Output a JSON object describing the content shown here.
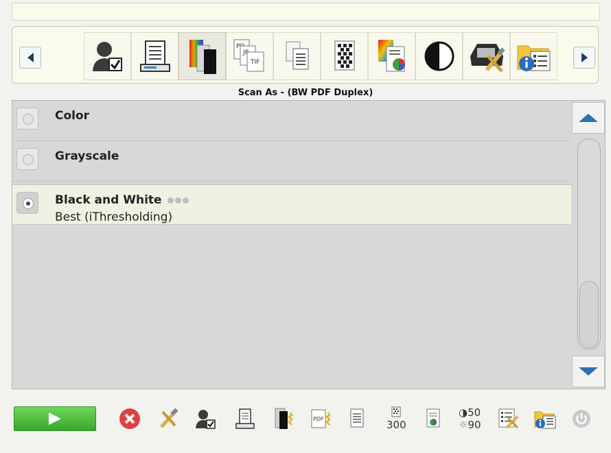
{
  "colors": {
    "accent": "#2d6fb0",
    "start": "#4dbb3c",
    "selected_row": "#f1f1e3"
  },
  "toolbar": {
    "left_icon": "triangle-left-icon",
    "right_icon": "triangle-right-icon",
    "tiles": [
      {
        "name": "tile-user-settings",
        "icon": "user-check-icon"
      },
      {
        "name": "tile-document-output",
        "icon": "document-printer-icon"
      },
      {
        "name": "tile-scan-as",
        "icon": "color-pages-icon",
        "selected": true
      },
      {
        "name": "tile-file-type",
        "icon": "file-formats-icon"
      },
      {
        "name": "tile-document-type",
        "icon": "pages-icon"
      },
      {
        "name": "tile-resolution",
        "icon": "dot-matrix-page-icon"
      },
      {
        "name": "tile-color-dropout",
        "icon": "color-page-pie-icon"
      },
      {
        "name": "tile-brightness-contrast",
        "icon": "half-circle-icon"
      },
      {
        "name": "tile-device-settings",
        "icon": "scanner-tools-icon"
      },
      {
        "name": "tile-info",
        "icon": "folder-info-icon"
      }
    ]
  },
  "caption": "Scan As - (BW PDF Duplex)",
  "options": [
    {
      "title": "Color",
      "subtitle": ""
    },
    {
      "title": "Grayscale",
      "subtitle": ""
    },
    {
      "title": "Black and White",
      "subtitle": "Best (iThresholding)"
    }
  ],
  "selected_option": "Black and White",
  "scroll": {
    "up_icon": "arrow-up-icon",
    "down_icon": "arrow-down-icon"
  },
  "bottom": {
    "resolution": "300",
    "contrast": "50",
    "brightness": "90"
  }
}
